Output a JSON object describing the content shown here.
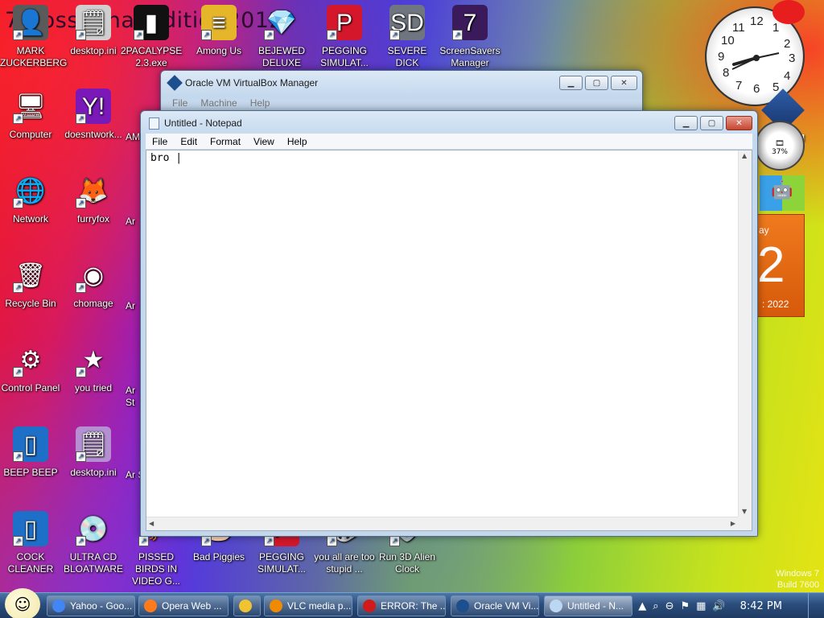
{
  "desktop": {
    "banner": "7 BossKanaeEdition2012",
    "icons": [
      {
        "label": "MARK ZUCKERBERG",
        "icon": "person-icon",
        "glyph": "👤",
        "bg": "#5a5a5a"
      },
      {
        "label": "desktop.ini",
        "icon": "settings-file-icon",
        "glyph": "🗒",
        "bg": "#cfcfcf"
      },
      {
        "label": "2PACALYPSE 2.3.exe",
        "icon": "console-icon",
        "glyph": "▮",
        "bg": "#111111"
      },
      {
        "label": "Among Us",
        "icon": "stack-icon",
        "glyph": "≡",
        "bg": "#e5b52a"
      },
      {
        "label": "BEJEWED DELUXE",
        "icon": "gem-icon",
        "glyph": "💎",
        "bg": "transparent"
      },
      {
        "label": "PEGGING SIMULAT...",
        "icon": "p-badge-icon",
        "glyph": "P",
        "bg": "#d4172b"
      },
      {
        "label": "SEVERE DICK",
        "icon": "gear-sd-icon",
        "glyph": "SD",
        "bg": "#6f7680"
      },
      {
        "label": "ScreenSavers Manager",
        "icon": "screensaver-icon",
        "glyph": "7",
        "bg": "#3a1a5a"
      },
      {
        "label": "Computer",
        "icon": "computer-icon",
        "glyph": "🖥",
        "bg": "transparent"
      },
      {
        "label": "doesntwork...",
        "icon": "yahoo-icon",
        "glyph": "Y!",
        "bg": "#7b18b8"
      },
      {
        "label": "Network",
        "icon": "network-icon",
        "glyph": "🌐",
        "bg": "transparent"
      },
      {
        "label": "furryfox",
        "icon": "firefox-icon",
        "glyph": "🦊",
        "bg": "transparent"
      },
      {
        "label": "Recycle Bin",
        "icon": "recycle-bin-icon",
        "glyph": "🗑",
        "bg": "transparent"
      },
      {
        "label": "chomage",
        "icon": "chrome-icon",
        "glyph": "◉",
        "bg": "transparent"
      },
      {
        "label": "Control Panel",
        "icon": "control-panel-icon",
        "glyph": "⚙",
        "bg": "transparent"
      },
      {
        "label": "you tried",
        "icon": "star-icon",
        "glyph": "★",
        "bg": "transparent"
      },
      {
        "label": "BEEP BEEP",
        "icon": "blue-file-icon",
        "glyph": "▯",
        "bg": "#1e6fc8"
      },
      {
        "label": "desktop.ini",
        "icon": "settings-file-icon",
        "glyph": "🗒",
        "bg": "#b48fd1"
      },
      {
        "label": "COCK CLEANER",
        "icon": "blue-file-icon",
        "glyph": "▯",
        "bg": "#1e6fc8"
      },
      {
        "label": "ULTRA CD BLOATWARE",
        "icon": "cd-icon",
        "glyph": "💿",
        "bg": "transparent"
      },
      {
        "label": "PISSED BIRDS IN VIDEO G...",
        "icon": "birds-icon",
        "glyph": "🐦",
        "bg": "transparent"
      },
      {
        "label": "Bad Piggies",
        "icon": "piggy-icon",
        "glyph": "🐷",
        "bg": "transparent"
      },
      {
        "label": "PEGGING SIMULAT...",
        "icon": "p-badge-icon",
        "glyph": "P",
        "bg": "#d4172b"
      },
      {
        "label": "you all are too stupid ...",
        "icon": "dice-icon",
        "glyph": "🎲",
        "bg": "transparent"
      },
      {
        "label": "Run 3D Alien Clock",
        "icon": "alien-clock-icon",
        "glyph": "👽",
        "bg": "transparent"
      }
    ],
    "partial_labels": [
      "AM",
      "Ar",
      "Ar",
      "Ar St",
      "Ar S"
    ]
  },
  "vbox": {
    "title": "Oracle VM VirtualBox Manager",
    "menu": [
      "File",
      "Machine",
      "Help"
    ]
  },
  "notepad": {
    "title": "Untitled - Notepad",
    "menu": [
      "File",
      "Edit",
      "Format",
      "View",
      "Help"
    ],
    "content": "bro |"
  },
  "gadgets": {
    "clock_numbers": [
      "12",
      "1",
      "2",
      "3",
      "4",
      "5",
      "6",
      "7",
      "8",
      "9",
      "10",
      "11"
    ],
    "gauge_value": "37%",
    "calendar_day": "ay",
    "calendar_date": "2",
    "calendar_year": ": 2022",
    "partial_vbox_label": "M\nx",
    "win_version": "Windows 7\nBuild 7600"
  },
  "taskbar": {
    "buttons": [
      {
        "label": "Yahoo - Goo...",
        "icon": "chrome-icon",
        "color": "#4285f4"
      },
      {
        "label": "Opera Web ...",
        "icon": "firefox-icon",
        "color": "#ff7a1a"
      },
      {
        "label": "",
        "icon": "folder-icon",
        "color": "#f1c232"
      },
      {
        "label": "VLC media p...",
        "icon": "vlc-icon",
        "color": "#f08a00"
      },
      {
        "label": "ERROR: The ...",
        "icon": "opera-icon",
        "color": "#d11a1a"
      },
      {
        "label": "Oracle VM Vi...",
        "icon": "virtualbox-icon",
        "color": "#1d4f8f"
      },
      {
        "label": "Untitled - N...",
        "icon": "notepad-icon",
        "color": "#bcd7f2"
      }
    ],
    "clock": "8:42 PM"
  },
  "colors": {
    "notepad_bg": "#ffffff",
    "taskbar_top": "#4b76a9",
    "close_red": "#c64530"
  }
}
